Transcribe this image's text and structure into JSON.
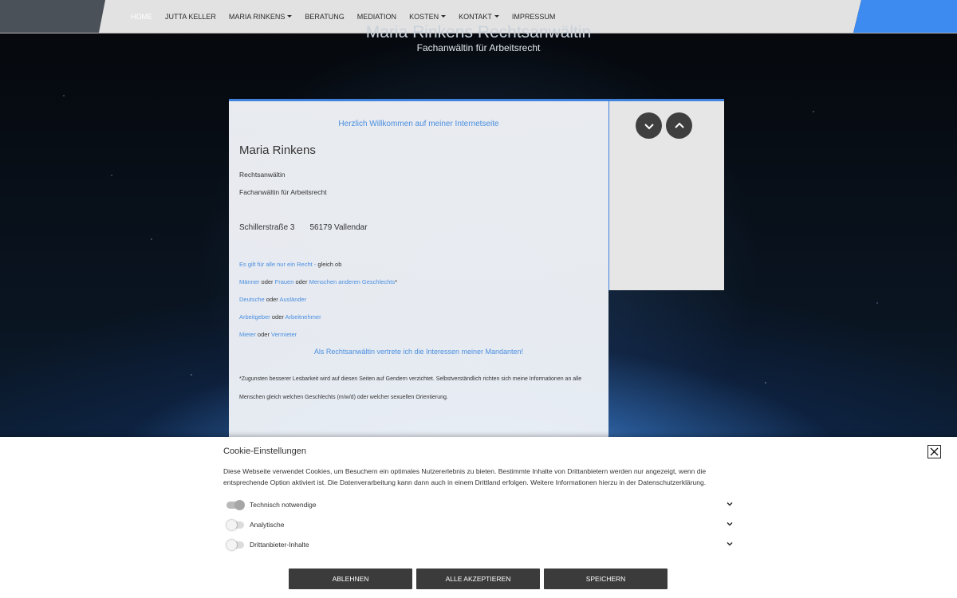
{
  "nav": {
    "items": [
      {
        "label": "HOME",
        "active": true,
        "dropdown": false
      },
      {
        "label": "JUTTA KELLER",
        "active": false,
        "dropdown": false
      },
      {
        "label": "MARIA RINKENS",
        "active": false,
        "dropdown": true
      },
      {
        "label": "BERATUNG",
        "active": false,
        "dropdown": false
      },
      {
        "label": "MEDIATION",
        "active": false,
        "dropdown": false
      },
      {
        "label": "KOSTEN",
        "active": false,
        "dropdown": true
      },
      {
        "label": "KONTAKT",
        "active": false,
        "dropdown": true
      },
      {
        "label": "IMPRESSUM",
        "active": false,
        "dropdown": false
      }
    ]
  },
  "header": {
    "title": "Maria Rinkens Rechtsanwältin",
    "subtitle": "Fachanwältin für Arbeitsrecht"
  },
  "main": {
    "welcome": "Herzlich Willkommen auf meiner Internetseite",
    "name": "Maria Rinkens",
    "role1": "Rechtsanwältin",
    "role2": "Fachanwältin für Arbeitsrecht",
    "street": "Schillerstraße 3",
    "city": "56179 Vallendar",
    "line1": {
      "link": "Es gilt für alle nur ein Recht -",
      "text": " gleich ob"
    },
    "line2": {
      "a": "Männer",
      "or1": " oder ",
      "b": "Frauen",
      "or2": " oder ",
      "c": "Menschen anderen Geschlechts",
      "mark": "*"
    },
    "line3": {
      "a": "Deutsche",
      "or": " oder ",
      "b": "Ausländer"
    },
    "line4": {
      "a": "Arbeitgeber",
      "or": " oder ",
      "b": "Arbeitnehmer"
    },
    "line5": {
      "a": "Mieter",
      "or": " oder ",
      "b": "Vermieter"
    },
    "statement": "Als Rechtsanwältin vertrete ich die Interessen meiner Mandanten!",
    "note": "*Zugunsten besserer Lesbarkeit wird auf diesen Seiten auf Gendern verzichtet. Selbstverständlich richten sich meine Informationen an alle Menschen gleich welchen Geschlechts (m/w/d) oder welcher sexuellen Orientierung."
  },
  "side": {
    "down_icon": "chevron-down-icon",
    "up_icon": "chevron-up-icon"
  },
  "cookie": {
    "title": "Cookie-Einstellungen",
    "description": "Diese Webseite verwendet Cookies, um Besuchern ein optimales Nutzererlebnis zu bieten. Bestimmte Inhalte von Drittanbietern werden nur angezeigt, wenn die entsprechende Option aktiviert ist. Die Datenverarbeitung kann dann auch in einem Drittland erfolgen. Weitere Informationen hierzu in der Datenschutzerklärung.",
    "toggles": [
      {
        "label": "Technisch notwendige",
        "on": true
      },
      {
        "label": "Analytische",
        "on": false
      },
      {
        "label": "Drittanbieter-Inhalte",
        "on": false
      }
    ],
    "buttons": {
      "reject": "ABLEHNEN",
      "accept_all": "ALLE AKZEPTIEREN",
      "save": "SPEICHERN"
    }
  },
  "colors": {
    "accent": "#3f82dd",
    "link": "#4a8ee0",
    "button": "#3b3b3b"
  }
}
